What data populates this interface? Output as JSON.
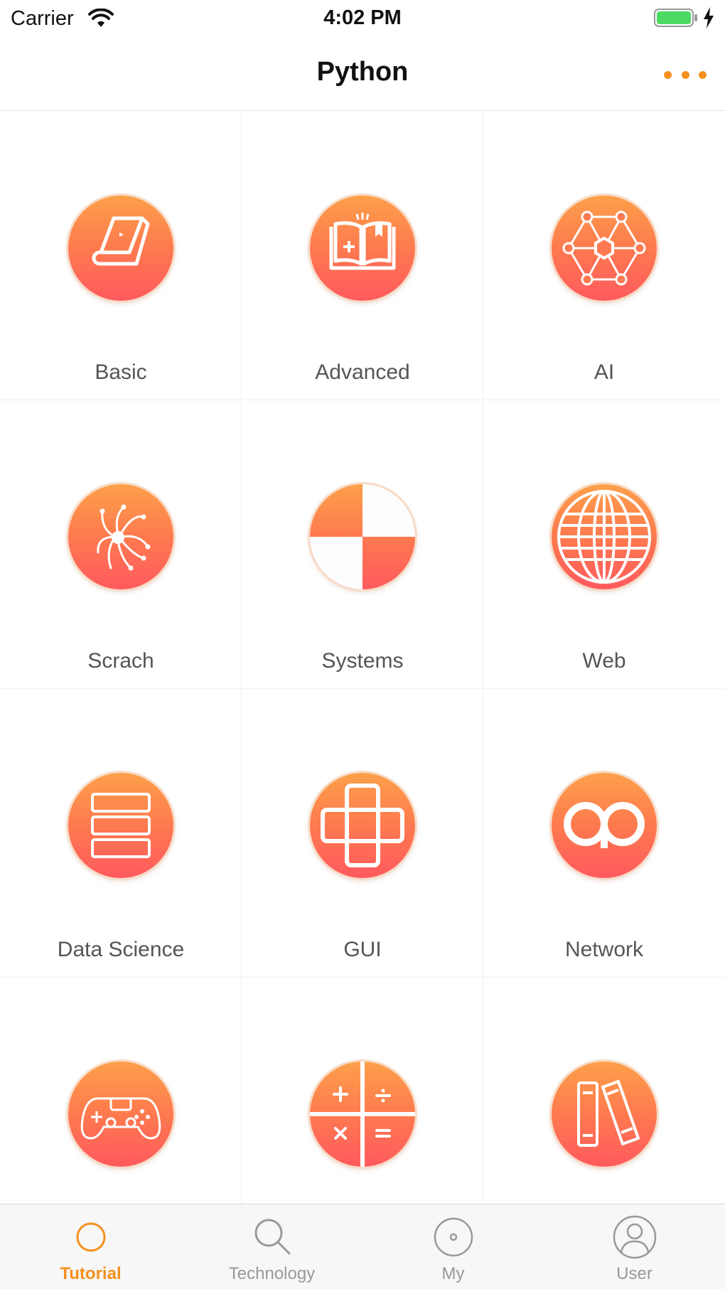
{
  "status_bar": {
    "carrier": "Carrier",
    "time": "4:02 PM"
  },
  "nav": {
    "title": "Python",
    "more_icon": "ellipsis-icon"
  },
  "grid": {
    "items": [
      {
        "label": "Basic",
        "icon": "notebook-icon"
      },
      {
        "label": "Advanced",
        "icon": "open-book-icon"
      },
      {
        "label": "AI",
        "icon": "network-nodes-icon"
      },
      {
        "label": "Scrach",
        "icon": "spider-icon"
      },
      {
        "label": "Systems",
        "icon": "quadrant-icon"
      },
      {
        "label": "Web",
        "icon": "globe-icon"
      },
      {
        "label": "Data Science",
        "icon": "database-stack-icon"
      },
      {
        "label": "GUI",
        "icon": "overlapping-squares-icon"
      },
      {
        "label": "Network",
        "icon": "linked-rings-icon"
      },
      {
        "label": "",
        "icon": "gamepad-icon"
      },
      {
        "label": "",
        "icon": "calculator-icon"
      },
      {
        "label": "",
        "icon": "books-icon"
      }
    ]
  },
  "tab_bar": {
    "tabs": [
      {
        "label": "Tutorial",
        "icon": "circle-icon",
        "active": true
      },
      {
        "label": "Technology",
        "icon": "search-icon",
        "active": false
      },
      {
        "label": "My",
        "icon": "disc-icon",
        "active": false
      },
      {
        "label": "User",
        "icon": "user-icon",
        "active": false
      }
    ]
  },
  "colors": {
    "accent": "#f5901e",
    "icon_gradient_top": "#fda04a",
    "icon_gradient_bottom": "#ff5a5e",
    "label_gray": "#555555",
    "tab_inactive": "#999999"
  }
}
